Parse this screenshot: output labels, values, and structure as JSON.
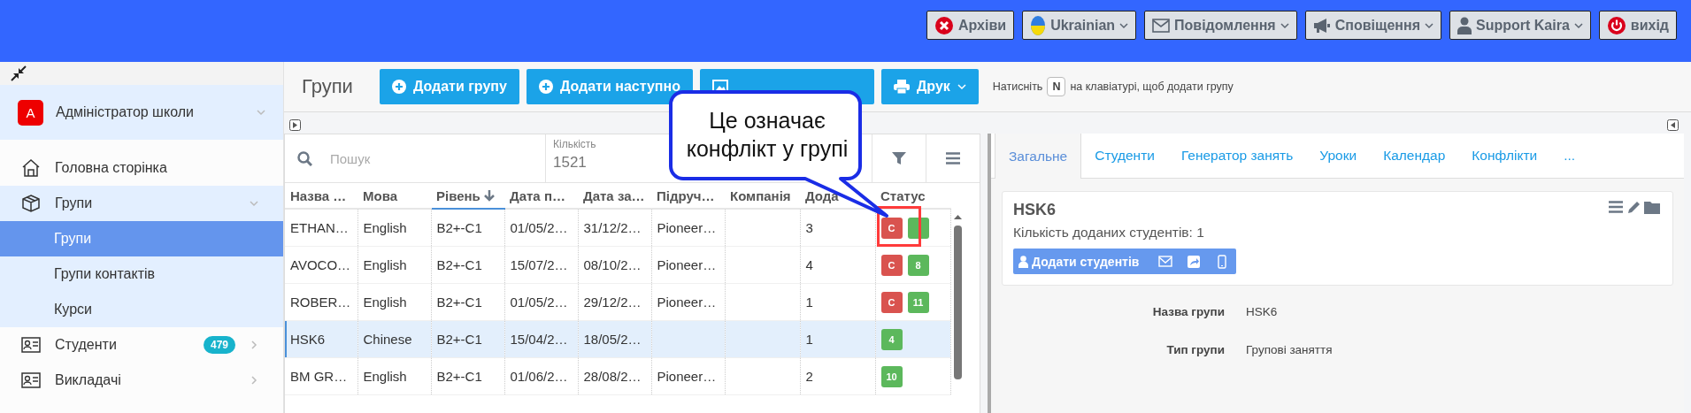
{
  "top_bar": {
    "buttons": [
      {
        "kind": "archive",
        "label": "Архіви",
        "dropdown": false
      },
      {
        "kind": "language",
        "label": "Ukrainian",
        "dropdown": true
      },
      {
        "kind": "messages",
        "label": "Повідомлення",
        "dropdown": true
      },
      {
        "kind": "notifications",
        "label": "Сповіщення",
        "dropdown": true
      },
      {
        "kind": "user",
        "label": "Support Kaira",
        "dropdown": true
      },
      {
        "kind": "logout",
        "label": "вихід",
        "dropdown": false
      }
    ]
  },
  "sidebar": {
    "profile": {
      "avatar": "А",
      "name": "Адміністратор школи",
      "expanded": false
    },
    "items": [
      {
        "kind": "home",
        "label": "Головна сторінка",
        "selected": false
      },
      {
        "kind": "box",
        "label": "Групи",
        "selected": false,
        "expanded": true,
        "children": [
          {
            "label": "Групи",
            "selected": true
          },
          {
            "label": "Групи контактів",
            "selected": false
          },
          {
            "label": "Курси",
            "selected": false
          }
        ]
      },
      {
        "kind": "card",
        "label": "Студенти",
        "selected": false,
        "expanded": false,
        "badge": "479"
      },
      {
        "kind": "card",
        "label": "Викладачі",
        "selected": false,
        "expanded": false
      }
    ]
  },
  "toolbar": {
    "title": "Групи",
    "buttons": [
      {
        "kind": "add",
        "label": "Додати групу",
        "dropdown": false
      },
      {
        "kind": "add",
        "label": "Додати наступно",
        "dropdown": false
      },
      {
        "kind": "export",
        "dropdown": false
      },
      {
        "kind": "print",
        "label": "Друк",
        "dropdown": true
      }
    ],
    "hint": {
      "before": "Натисніть",
      "key": "N",
      "after": "на клавіатурі, щоб додати групу"
    }
  },
  "table": {
    "search": {
      "placeholder": "Пошук"
    },
    "count": {
      "label": "Кількість",
      "value": "1521"
    },
    "columns": [
      {
        "label": "Назва …",
        "sorted": false
      },
      {
        "label": "Мова",
        "sorted": false
      },
      {
        "label": "Рівень",
        "sorted": true
      },
      {
        "label": "Дата п…",
        "sorted": false
      },
      {
        "label": "Дата за…",
        "sorted": false
      },
      {
        "label": "Підруч…",
        "sorted": false
      },
      {
        "label": "Компанія",
        "sorted": false
      },
      {
        "label": "Дода",
        "sorted": false
      },
      {
        "label": "Статус",
        "sorted": false
      }
    ],
    "rows": [
      {
        "selected": false,
        "cells": [
          "ETHAN…",
          "English",
          "B2+-C1",
          "01/05/2…",
          "31/12/2…",
          "Pioneer…",
          null,
          "3"
        ],
        "badges": [
          {
            "kind": "conflict",
            "label": "C",
            "highlighted": true
          },
          {
            "kind": "count",
            "highlighted": false
          }
        ]
      },
      {
        "selected": false,
        "cells": [
          "AVOCO…",
          "English",
          "B2+-C1",
          "15/07/2…",
          "08/10/2…",
          "Pioneer…",
          null,
          "4"
        ],
        "badges": [
          {
            "kind": "conflict",
            "label": "C",
            "highlighted": false
          },
          {
            "kind": "count",
            "label": "8",
            "highlighted": false
          }
        ]
      },
      {
        "selected": false,
        "cells": [
          "ROBER…",
          "English",
          "B2+-C1",
          "01/05/2…",
          "29/12/2…",
          "Pioneer…",
          null,
          "1"
        ],
        "badges": [
          {
            "kind": "conflict",
            "label": "C",
            "highlighted": false
          },
          {
            "kind": "count",
            "label": "11",
            "highlighted": false
          }
        ]
      },
      {
        "selected": true,
        "cells": [
          "HSK6",
          "Chinese",
          "B2+-C1",
          "15/04/2…",
          "18/05/2…",
          null,
          null,
          "1"
        ],
        "badges": [
          {
            "kind": "count",
            "label": "4",
            "highlighted": false
          }
        ]
      },
      {
        "selected": false,
        "cells": [
          "BM GR…",
          "English",
          "B2+-C1",
          "01/06/2…",
          "28/08/2…",
          "Pioneer…",
          null,
          "2"
        ],
        "badges": [
          {
            "kind": "count",
            "label": "10",
            "highlighted": false
          }
        ]
      }
    ]
  },
  "detail": {
    "tabs": [
      {
        "label": "Загальне",
        "selected": true
      },
      {
        "label": "Студенти",
        "selected": false
      },
      {
        "label": "Генератор занять",
        "selected": false
      },
      {
        "label": "Уроки",
        "selected": false
      },
      {
        "label": "Календар",
        "selected": false
      },
      {
        "label": "Конфлікти",
        "selected": false
      },
      {
        "label": "...",
        "selected": false
      }
    ],
    "card": {
      "title": "HSK6",
      "subtitle": "Кількість доданих студентів: 1",
      "button": "Додати студентів"
    },
    "fields": [
      {
        "label": "Назва групи",
        "value": "HSK6"
      },
      {
        "label": "Тип групи",
        "value": "Групові заняття"
      }
    ]
  },
  "callout": {
    "text": "Це означає конфлікт у групі"
  }
}
